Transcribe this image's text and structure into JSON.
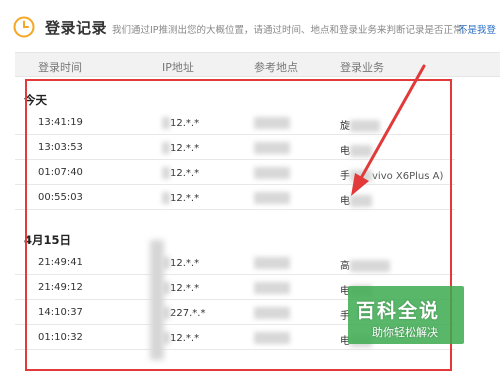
{
  "header": {
    "title": "登录记录",
    "description": "我们通过IP推测出您的大概位置，请通过时间、地点和登录业务来判断记录是否正常。",
    "help_link": "不是我登"
  },
  "columns": [
    "登录时间",
    "IP地址",
    "参考地点",
    "登录业务"
  ],
  "groups": [
    {
      "label": "今天",
      "rows": [
        {
          "time": "13:41:19",
          "ip": "12.*.*",
          "service": "旋"
        },
        {
          "time": "13:03:53",
          "ip": "12.*.*",
          "service": "电"
        },
        {
          "time": "01:07:40",
          "ip": "12.*.*",
          "service": "手",
          "service_extra": "vivo X6Plus A)"
        },
        {
          "time": "00:55:03",
          "ip": "12.*.*",
          "service": "电"
        }
      ]
    },
    {
      "label": "4月15日",
      "rows": [
        {
          "time": "21:49:41",
          "ip": "12.*.*",
          "service": "高"
        },
        {
          "time": "21:49:12",
          "ip": "12.*.*",
          "service": "电"
        },
        {
          "time": "14:10:37",
          "ip": "227.*.*",
          "service": "手"
        },
        {
          "time": "01:10:32",
          "ip": "12.*.*",
          "service": "电"
        }
      ]
    }
  ],
  "watermark": {
    "line1": "百科全说",
    "line2": "助你轻松解决"
  },
  "colors": {
    "highlight": "#e23a3a",
    "link": "#2b6fc4",
    "accent": "#f5a623"
  }
}
